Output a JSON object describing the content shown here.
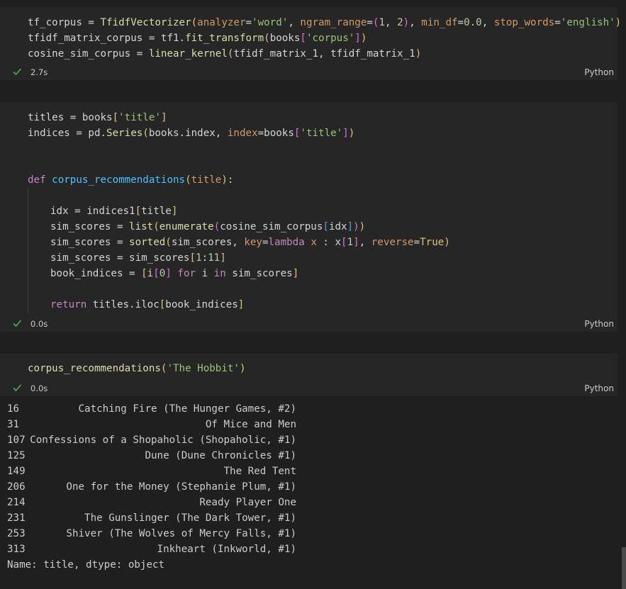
{
  "cells": [
    {
      "lines": [
        "tf_corpus = TfidfVectorizer(analyzer='word', ngram_range=(1, 2), min_df=0.0, stop_words='english')",
        "tfidf_matrix_corpus = tf1.fit_transform(books['corpus'])",
        "cosine_sim_corpus = linear_kernel(tfidf_matrix_1, tfidf_matrix_1)"
      ],
      "status": {
        "time": "2.7s",
        "language": "Python"
      }
    },
    {
      "lines": [
        "titles = books['title']",
        "indices = pd.Series(books.index, index=books['title'])",
        "",
        "",
        "def corpus_recommendations(title):",
        "",
        "    idx = indices1[title]",
        "    sim_scores = list(enumerate(cosine_sim_corpus[idx]))",
        "    sim_scores = sorted(sim_scores, key=lambda x : x[1], reverse=True)",
        "    sim_scores = sim_scores[1:11]",
        "    book_indices = [i[0] for i in sim_scores]",
        "",
        "    return titles.iloc[book_indices]"
      ],
      "status": {
        "time": "0.0s",
        "language": "Python"
      }
    },
    {
      "lines": [
        "corpus_recommendations('The Hobbit')"
      ],
      "status": {
        "time": "0.0s",
        "language": "Python"
      }
    }
  ],
  "output": {
    "rows": [
      {
        "index": "16",
        "title": "Catching Fire (The Hunger Games, #2)"
      },
      {
        "index": "31",
        "title": "Of Mice and Men"
      },
      {
        "index": "107",
        "title": "Confessions of a Shopaholic (Shopaholic, #1)"
      },
      {
        "index": "125",
        "title": "Dune (Dune Chronicles #1)"
      },
      {
        "index": "149",
        "title": "The Red Tent"
      },
      {
        "index": "206",
        "title": "One for the Money (Stephanie Plum, #1)"
      },
      {
        "index": "214",
        "title": "Ready Player One"
      },
      {
        "index": "231",
        "title": "The Gunslinger (The Dark Tower, #1)"
      },
      {
        "index": "253",
        "title": "Shiver (The Wolves of Mercy Falls, #1)"
      },
      {
        "index": "313",
        "title": "Inkheart (Inkworld, #1)"
      }
    ],
    "footer": "Name: title, dtype: object"
  },
  "icons": {
    "status_check": "check-icon"
  },
  "colors": {
    "success": "#3fb950",
    "background": "#1f1f1f",
    "cell_background": "#262626"
  }
}
